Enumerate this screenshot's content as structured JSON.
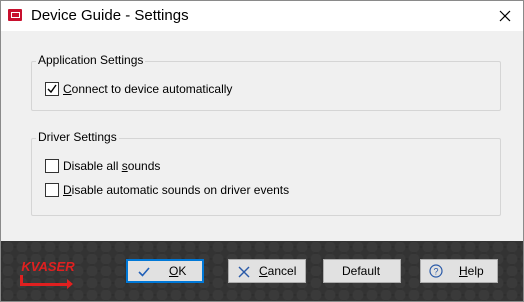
{
  "window": {
    "title": "Device Guide - Settings"
  },
  "application_settings": {
    "title": "Application Settings",
    "options": [
      {
        "label_prefix": "",
        "label_mnemonic": "C",
        "label_rest": "onnect to device automatically",
        "checked": true
      }
    ]
  },
  "driver_settings": {
    "title": "Driver Settings",
    "options": [
      {
        "label_prefix": "Disable all ",
        "label_mnemonic": "s",
        "label_rest": "ounds",
        "checked": false
      },
      {
        "label_prefix": "",
        "label_mnemonic": "D",
        "label_rest": "isable automatic sounds on driver events",
        "checked": false
      }
    ]
  },
  "footer": {
    "brand": "KVASER",
    "buttons": {
      "ok": {
        "mnemonic": "O",
        "rest": "K"
      },
      "cancel": {
        "mnemonic": "C",
        "rest": "ancel"
      },
      "default": {
        "label": "Default"
      },
      "help": {
        "mnemonic": "H",
        "rest": "elp"
      }
    }
  },
  "colors": {
    "accent": "#0078d7",
    "brand_red": "#c8102e",
    "footer_bg": "#2b2b2b"
  },
  "icons": {
    "app": "kvaser-app-icon",
    "close": "close-icon",
    "ok": "checkmark-icon",
    "cancel": "x-icon",
    "help": "help-circle-icon"
  }
}
